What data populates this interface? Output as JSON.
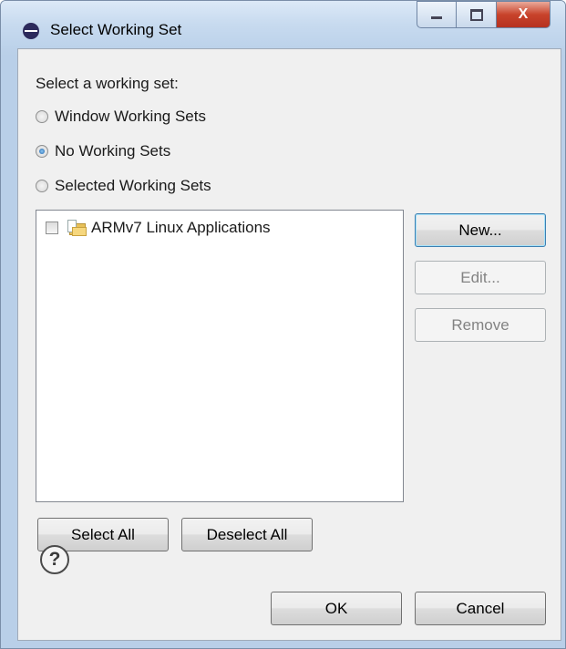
{
  "window": {
    "title": "Select Working Set",
    "close_glyph": "X"
  },
  "dialog": {
    "prompt": "Select a working set:",
    "options": [
      {
        "label": "Window Working Sets",
        "selected": false
      },
      {
        "label": "No Working Sets",
        "selected": true
      },
      {
        "label": "Selected Working Sets",
        "selected": false
      }
    ],
    "working_sets": [
      {
        "label": "ARMv7 Linux Applications",
        "checked": false,
        "icon": "working-set-folder-icon"
      }
    ],
    "side_buttons": {
      "new": "New...",
      "edit": "Edit...",
      "remove": "Remove"
    },
    "select_all": "Select All",
    "deselect_all": "Deselect All",
    "help_glyph": "?",
    "ok": "OK",
    "cancel": "Cancel"
  },
  "colors": {
    "accent": "#3c7fb1",
    "close_button": "#c8432b",
    "titlebar": "#c7daef"
  }
}
